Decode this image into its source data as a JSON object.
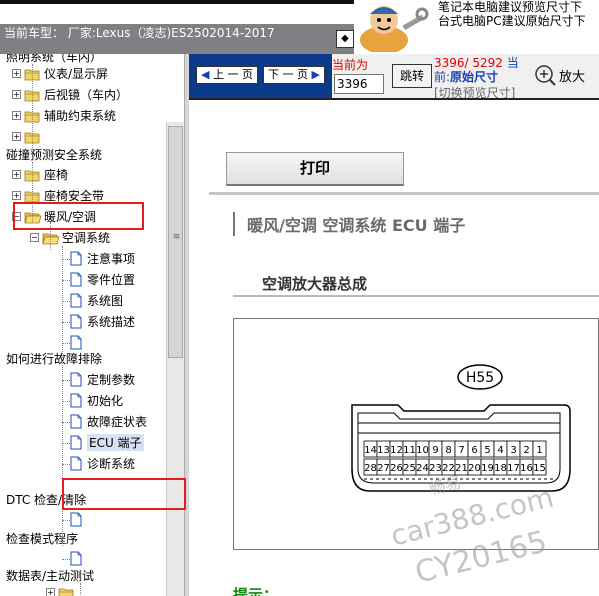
{
  "header": {
    "car_model_label": "当前车型：",
    "car_model_value": "厂家:Lexus（凌志)ES2502014-2017",
    "notice_line1": "笔记本电脑建议预览尺寸下",
    "notice_line2": "台式电脑PC建议原始尺寸下",
    "nav_arrow": "◆"
  },
  "tree": {
    "items": [
      {
        "label": "照明系统（车内）",
        "toggle": ""
      },
      {
        "label": "仪表/显示屏",
        "toggle": "+"
      },
      {
        "label": "后视镜（车内）",
        "toggle": "+"
      },
      {
        "label": "辅助约束系统",
        "toggle": "+"
      },
      {
        "label": "",
        "toggle": "+"
      },
      {
        "label": "碰撞预测安全系统",
        "toggle": ""
      },
      {
        "label": "座椅",
        "toggle": "+"
      },
      {
        "label": "座椅安全带",
        "toggle": "+"
      },
      {
        "label": "暖风/空调",
        "toggle": "−"
      },
      {
        "label": "空调系统",
        "toggle": "−"
      },
      {
        "label": "注意事项",
        "toggle": ""
      },
      {
        "label": "零件位置",
        "toggle": ""
      },
      {
        "label": "系统图",
        "toggle": ""
      },
      {
        "label": "系统描述",
        "toggle": ""
      },
      {
        "label": "",
        "toggle": ""
      },
      {
        "label": "如何进行故障排除",
        "toggle": ""
      },
      {
        "label": "定制参数",
        "toggle": ""
      },
      {
        "label": "初始化",
        "toggle": ""
      },
      {
        "label": "故障症状表",
        "toggle": ""
      },
      {
        "label": "ECU 端子",
        "toggle": ""
      },
      {
        "label": "诊断系统",
        "toggle": ""
      },
      {
        "label": "DTC 检查/清除",
        "toggle": ""
      },
      {
        "label": "",
        "toggle": ""
      },
      {
        "label": "检查模式程序",
        "toggle": ""
      },
      {
        "label": "",
        "toggle": ""
      },
      {
        "label": "数据表/主动测试",
        "toggle": ""
      },
      {
        "label": "",
        "toggle": "+"
      }
    ],
    "scroll_grip": "≡"
  },
  "toolbar": {
    "prev_page": "上 一 页",
    "next_page": "下 一 页",
    "current_label": "当前为",
    "page_input_value": "3396",
    "jump_label": "跳转",
    "page_count": "3396/ 5292",
    "page_count_suffix": "当",
    "orig_prefix": "前:",
    "orig_size_label": "原始尺寸",
    "switch_preview": "[切换预览尺寸]",
    "zoom_label": "放大"
  },
  "doc": {
    "print_label": "打印",
    "heading": "暖风/空调  空调系统  ECU 端子",
    "subtitle": "空调放大器总成",
    "connector_label": "H55",
    "pins_top": [
      "14",
      "13",
      "12",
      "11",
      "10",
      "9",
      "8",
      "7",
      "6",
      "5",
      "4",
      "3",
      "2",
      "1"
    ],
    "pins_bottom": [
      "28",
      "27",
      "26",
      "25",
      "24",
      "23",
      "22",
      "21",
      "20",
      "19",
      "18",
      "17",
      "16",
      "15"
    ],
    "hint": "提示："
  },
  "watermark": {
    "line1": "car388.com",
    "line2": "CY20165",
    "line3": "畅易"
  },
  "colors": {
    "toolbar_blue": "#0d3b8c",
    "highlight_red": "#e02020",
    "hint_green": "#138a13"
  }
}
